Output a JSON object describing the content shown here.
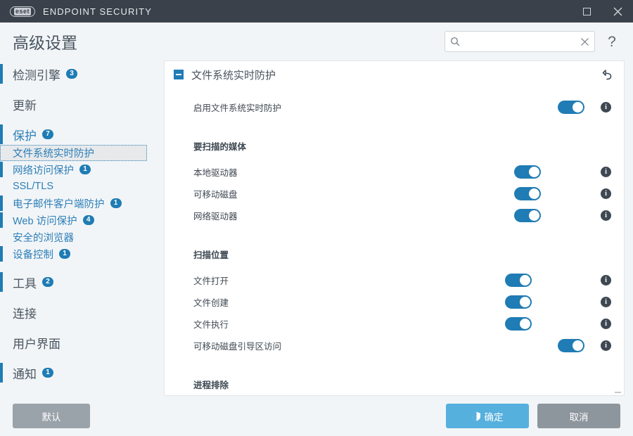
{
  "window": {
    "brand": "eset",
    "app_title": "ENDPOINT SECURITY",
    "maximize_label": "",
    "close_label": "✕"
  },
  "header": {
    "page_title": "高级设置",
    "search": {
      "value": "",
      "placeholder": ""
    },
    "help_label": "?"
  },
  "sidebar": {
    "items": [
      {
        "label": "检测引擎",
        "badge": "3",
        "level": "top",
        "accent": true,
        "selected": false
      },
      {
        "label": "更新",
        "badge": "",
        "level": "top",
        "accent": false,
        "selected": false
      },
      {
        "label": "保护",
        "badge": "7",
        "level": "top-link",
        "accent": true,
        "selected": false
      },
      {
        "label": "文件系统实时防护",
        "badge": "",
        "level": "sub",
        "accent": false,
        "selected": true
      },
      {
        "label": "网络访问保护",
        "badge": "1",
        "level": "sub",
        "accent": true,
        "selected": false
      },
      {
        "label": "SSL/TLS",
        "badge": "",
        "level": "sub",
        "accent": false,
        "selected": false
      },
      {
        "label": "电子邮件客户端防护",
        "badge": "1",
        "level": "sub",
        "accent": true,
        "selected": false
      },
      {
        "label": "Web 访问保护",
        "badge": "4",
        "level": "sub",
        "accent": true,
        "selected": false
      },
      {
        "label": "安全的浏览器",
        "badge": "",
        "level": "sub",
        "accent": false,
        "selected": false
      },
      {
        "label": "设备控制",
        "badge": "1",
        "level": "sub",
        "accent": true,
        "selected": false
      },
      {
        "label": "工具",
        "badge": "2",
        "level": "top",
        "accent": true,
        "selected": false
      },
      {
        "label": "连接",
        "badge": "",
        "level": "top",
        "accent": false,
        "selected": false
      },
      {
        "label": "用户界面",
        "badge": "",
        "level": "top",
        "accent": false,
        "selected": false
      },
      {
        "label": "通知",
        "badge": "1",
        "level": "top",
        "accent": true,
        "selected": false
      }
    ]
  },
  "panel": {
    "title": "文件系统实时防护",
    "main_row": {
      "label": "启用文件系统实时防护",
      "state": "on",
      "info": "i"
    },
    "sections": [
      {
        "title": "要扫描的媒体",
        "rows": [
          {
            "label": "本地驱动器",
            "state": "on",
            "info": "i"
          },
          {
            "label": "可移动磁盘",
            "state": "on",
            "info": "i"
          },
          {
            "label": "网络驱动器",
            "state": "on",
            "info": "i"
          }
        ]
      },
      {
        "title": "扫描位置",
        "rows": [
          {
            "label": "文件打开",
            "state": "on",
            "info": "i"
          },
          {
            "label": "文件创建",
            "state": "on",
            "info": "i"
          },
          {
            "label": "文件执行",
            "state": "on",
            "info": "i"
          },
          {
            "label": "可移动磁盘引导区访问",
            "state": "on",
            "info": "i"
          }
        ]
      },
      {
        "title": "进程排除",
        "rows": []
      }
    ]
  },
  "footer": {
    "default_label": "默认",
    "ok_label": "确定",
    "cancel_label": "取消"
  },
  "colors": {
    "accent_blue": "#1f7cb4",
    "titlebar": "#3a414b",
    "ok_button": "#55b0dd",
    "gray_button": "#9aa2aa",
    "page_bg": "#f2f5f7"
  }
}
